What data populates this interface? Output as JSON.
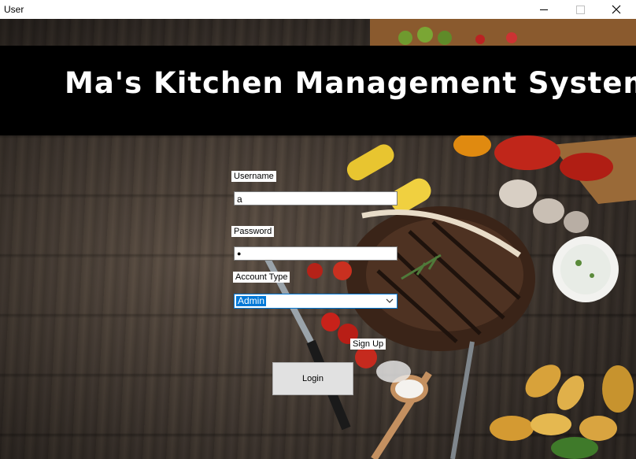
{
  "window": {
    "title": "User"
  },
  "header": {
    "title": "Ma's Kitchen Management System"
  },
  "form": {
    "username_label": "Username",
    "username_value": "a",
    "password_label": "Password",
    "password_value": "●",
    "account_type_label": "Account Type",
    "account_type_value": "Admin",
    "signup_label": "Sign Up",
    "login_label": "Login"
  },
  "colors": {
    "banner": "#000000",
    "selection": "#0078d7",
    "button": "#e1e1e1"
  }
}
